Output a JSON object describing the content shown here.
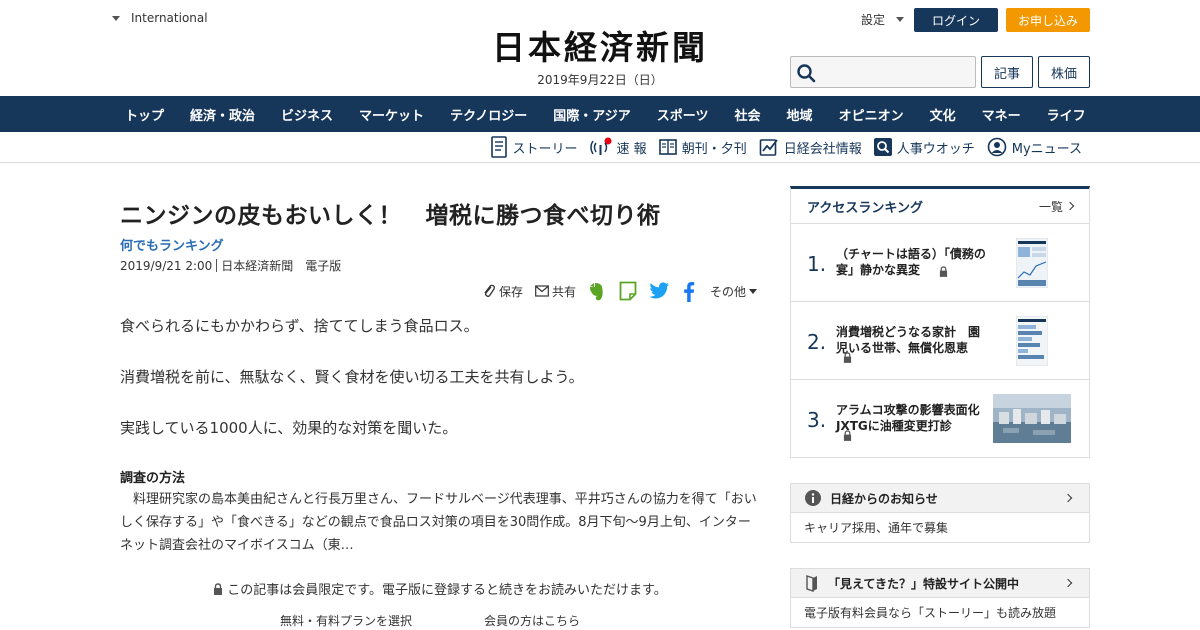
{
  "header": {
    "international": "International",
    "logo": "日本経済新聞",
    "date": "2019年9月22日（日）",
    "settings": "設定",
    "login": "ログイン",
    "apply": "お申し込み",
    "search_placeholder": "",
    "btn_articles": "記事",
    "btn_stocks": "株価"
  },
  "nav": [
    "トップ",
    "経済・政治",
    "ビジネス",
    "マーケット",
    "テクノロジー",
    "国際・アジア",
    "スポーツ",
    "社会",
    "地域",
    "オピニオン",
    "文化",
    "マネー",
    "ライフ"
  ],
  "subnav": {
    "story": "ストーリー",
    "breaking": "速 報",
    "papers": "朝刊・夕刊",
    "company": "日経会社情報",
    "personnel": "人事ウオッチ",
    "mynews": "Myニュース"
  },
  "article": {
    "title": "ニンジンの皮もおいしく！　増税に勝つ食べ切り術",
    "series": "何でもランキング",
    "datetime": "2019/9/21 2:00",
    "source": "日本経済新聞　電子版",
    "share": {
      "save": "保存",
      "share": "共有",
      "more": "その他"
    },
    "paragraphs": [
      "食べられるにもかかわらず、捨ててしまう食品ロス。",
      "消費増税を前に、無駄なく、賢く食材を使い切る工夫を共有しよう。",
      "実践している1000人に、効果的な対策を聞いた。"
    ],
    "method_heading": "調査の方法",
    "method_text": "料理研究家の島本美由紀さんと行長万里さん、フードサルベージ代表理事、平井巧さんの協力を得て「おいしく保存する」や「食べきる」などの観点で食品ロス対策の項目を30問作成。8月下旬～9月上旬、インターネット調査会社のマイボイスコム（東…",
    "paywall": "この記事は会員限定です。電子版に登録すると続きをお読みいただけます。",
    "plan_link": "無料・有料プランを選択",
    "member_link": "会員の方はこちら"
  },
  "ranking": {
    "title": "アクセスランキング",
    "more": "一覧",
    "items": [
      {
        "num": "1.",
        "text": "（チャートは語る）「債務の宴」静かな異変"
      },
      {
        "num": "2.",
        "text": "消費増税どうなる家計　園児いる世帯、無償化恩恵"
      },
      {
        "num": "3.",
        "text": "アラムコ攻撃の影響表面化　JXTGに油種変更打診"
      }
    ]
  },
  "notice1": {
    "title": "日経からのお知らせ",
    "body": "キャリア採用、通年で募集"
  },
  "notice2": {
    "title": "「見えてきた？」特設サイト公開中",
    "body": "電子版有料会員なら「ストーリー」も読み放題"
  },
  "colors": {
    "navy": "#16365a",
    "orange": "#f39800",
    "link_blue": "#2a6db3",
    "breaking_red": "#e60012",
    "evernote_green": "#5ba525",
    "twitter_blue": "#1da1f2",
    "facebook_blue": "#1877f2"
  }
}
